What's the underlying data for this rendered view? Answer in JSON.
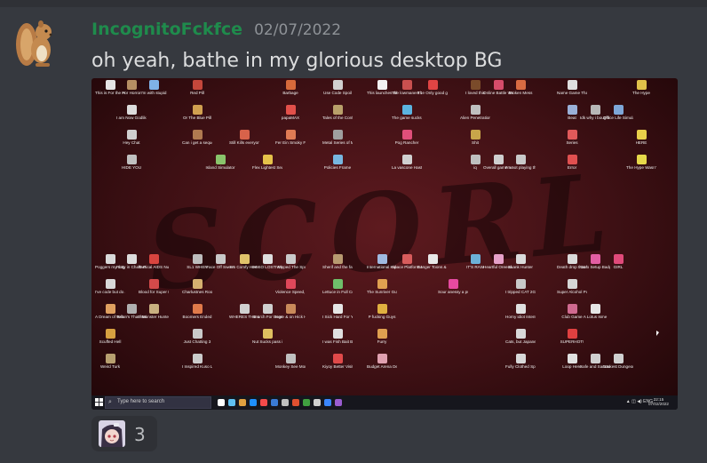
{
  "message": {
    "username": "IncognitoFckfce",
    "timestamp": "02/07/2022",
    "text": "oh yeah, bathe in my glorious desktop BG",
    "name_color": "#1f8b4c"
  },
  "attachment": {
    "wallpaper_text": "SCORL",
    "desktop_icons": [
      {
        "label": "This is For the Horror",
        "color": "#e5e5e5",
        "icon": "recycle-bin-icon"
      },
      {
        "label": "For Horror",
        "color": "#b58f63"
      },
      {
        "label": "I'm with stupid",
        "color": "#7fb2e8"
      },
      {
        "label": "Red Pill",
        "color": "#c4473b"
      },
      {
        "label": "Barbage",
        "color": "#d76a3b"
      },
      {
        "label": "Use Code Spoil",
        "color": "#d0d0d0"
      },
      {
        "label": "This launches Shitty Yt",
        "color": "#f2f2f2"
      },
      {
        "label": "The lowmanent 2",
        "color": "#c9504f"
      },
      {
        "label": "The Only good gu...",
        "color": "#e04444"
      },
      {
        "label": "I loved this",
        "color": "#7a4b2a"
      },
      {
        "label": "Online Battle Waifu creator",
        "color": "#d64c6a"
      },
      {
        "label": "Broken Mess",
        "color": "#d86b42"
      },
      {
        "label": "Name Game Thanks You",
        "color": "#dfdfdf"
      },
      {
        "label": "The Hype",
        "color": "#e0c24a"
      },
      {
        "label": "I am Now Godlike",
        "color": "#dcdcdc"
      },
      {
        "label": "Or The Blue Pill",
        "color": "#d0a050"
      },
      {
        "label": "papaMAX",
        "color": "#e2504a"
      },
      {
        "label": "Tales of the Configuration",
        "color": "#b9a06a"
      },
      {
        "label": "The game sucks. fu...",
        "color": "#5bb4e0"
      },
      {
        "label": "Alien Penetration",
        "color": "#bfbfbf"
      },
      {
        "label": "Beat",
        "color": "#9ab0d8"
      },
      {
        "label": "Idk why i bought this",
        "color": "#b7b7b7"
      },
      {
        "label": "Office Life Simulator",
        "color": "#7ea7d8"
      },
      {
        "label": "Hey Chat",
        "color": "#cfcfcf"
      },
      {
        "label": "Can i get a sequel",
        "color": "#b07a50"
      },
      {
        "label": "Still Kills everyone...",
        "color": "#d7624a"
      },
      {
        "label": "Fer Ein Smoky Face",
        "color": "#e07b54"
      },
      {
        "label": "Metal Series of Madness",
        "color": "#9f9f9f"
      },
      {
        "label": "Pog Rancher",
        "color": "#e04f7a"
      },
      {
        "label": "Shit",
        "color": "#c8a64a"
      },
      {
        "label": "Series",
        "color": "#e05a5a"
      },
      {
        "label": "HERE",
        "color": "#e8d04a"
      },
      {
        "label": "HIDE YOU",
        "color": "#c0c0c0"
      },
      {
        "label": "Island Simulator",
        "color": "#89c46b"
      },
      {
        "label": "Flex Lightest Seat Ever",
        "color": "#e5c24a"
      },
      {
        "label": "Policies Frame",
        "color": "#77b7e0"
      },
      {
        "label": "La vascone Hasty",
        "color": "#d0d0d0"
      },
      {
        "label": "iq",
        "color": "#bfbfbf"
      },
      {
        "label": "Overall game no...",
        "color": "#cfcfcf"
      },
      {
        "label": "I'm not playing this",
        "color": "#c9c9c9"
      },
      {
        "label": "Error",
        "color": "#e05050"
      },
      {
        "label": "The Hype Wasn't Here",
        "color": "#e6d84a"
      },
      {
        "label": "Poggers my doggers",
        "color": "#d9d9d9"
      },
      {
        "label": "Potty in Chafe Pants",
        "color": "#dcdcdc"
      },
      {
        "label": "Tactical AIDS Nuke",
        "color": "#d8453f"
      },
      {
        "label": "SL1 WHEN",
        "color": "#bdbdbd"
      },
      {
        "label": "Face Off Sweet",
        "color": "#c8c8c8"
      },
      {
        "label": "I'm Comfy Here",
        "color": "#e0c26a"
      },
      {
        "label": "IM SO LOST WHATS THIS",
        "color": "#dedede"
      },
      {
        "label": "I Kipped The Spot",
        "color": "#cacaca"
      },
      {
        "label": "Sherif and the fate o...",
        "color": "#b89a70"
      },
      {
        "label": "International Kid Terrorist",
        "color": "#9fb9e0"
      },
      {
        "label": "Space Platform 6.75",
        "color": "#d85c5c"
      },
      {
        "label": "Banger Toons & Headbook",
        "color": "#e8e8e8"
      },
      {
        "label": "IT'S RAW",
        "color": "#6cb0d8"
      },
      {
        "label": "Heartful Oreena Key",
        "color": "#e5a0c8"
      },
      {
        "label": "Skank Hunter",
        "color": "#dadada"
      },
      {
        "label": "Death drop that fat ass",
        "color": "#d9d9d9"
      },
      {
        "label": "Guro Setup Badge",
        "color": "#e25ea2"
      },
      {
        "label": "GIRL",
        "color": "#e04a7a"
      },
      {
        "label": "I've code but do actually...",
        "color": "#d8d8d8"
      },
      {
        "label": "Blood for Super Kiel",
        "color": "#d24a4a"
      },
      {
        "label": "Charlustnes Room",
        "color": "#d5b070"
      },
      {
        "label": "Violence Speed, M...",
        "color": "#e0485a"
      },
      {
        "label": "Lettuce in Full Cotton",
        "color": "#6fbf6a"
      },
      {
        "label": "The Sunriver Guys",
        "color": "#e0a050"
      },
      {
        "label": "Sour anessy a punk",
        "color": "#e64aa0"
      },
      {
        "label": "I tripped CAT 2G & BATH",
        "color": "#c9c9c9"
      },
      {
        "label": "Super Alcohol Puzzle",
        "color": "#d6d6d6"
      },
      {
        "label": "A Dream of Iran Make 2",
        "color": "#e0a060"
      },
      {
        "label": "Tellan's That Walls",
        "color": "#b0b0b0"
      },
      {
        "label": "If Monster Hunter m...",
        "color": "#c9b080"
      },
      {
        "label": "Boomers Ended",
        "color": "#e07a4a"
      },
      {
        "label": "WHERES THE LAMB SAUCE",
        "color": "#d0d0d0"
      },
      {
        "label": "Search For Bugs Daps",
        "color": "#cfcfcf"
      },
      {
        "label": "Here & on Hick Hatspring",
        "color": "#c98a5a"
      },
      {
        "label": "I Sick Hard For You",
        "color": "#e6e6e6"
      },
      {
        "label": "P fucking Guys",
        "color": "#e0b040"
      },
      {
        "label": "Horny idiot Intent Sims",
        "color": "#e0e0e0"
      },
      {
        "label": "Club Game",
        "color": "#d06a90"
      },
      {
        "label": "A Lotus Isme",
        "color": "#e5e5e5"
      },
      {
        "label": "Scuffed Hell",
        "color": "#d7a040"
      },
      {
        "label": "Just Chatting 3",
        "color": "#c9c9c9"
      },
      {
        "label": "Nut Sucks pass it on",
        "color": "#e0c060"
      },
      {
        "label": "I was Fish Bait Bot",
        "color": "#e0e0e0"
      },
      {
        "label": "Furry",
        "color": "#e0a050"
      },
      {
        "label": "Cats, but Japanese",
        "color": "#d8d8d8"
      },
      {
        "label": "SUPERHOT!",
        "color": "#e04040"
      },
      {
        "label": "Weird Turk",
        "color": "#b8a070"
      },
      {
        "label": "I Inspired Kuso Lichen",
        "color": "#cbcbcb"
      },
      {
        "label": "Monkey See Monkey Do",
        "color": "#c0c0c0"
      },
      {
        "label": "Kiyoy Better Visit My Ass",
        "color": "#e04a4a"
      },
      {
        "label": "Budget Arena Dead Island",
        "color": "#e0a0b0"
      },
      {
        "label": "Fully Clothed Sparkle Icon",
        "color": "#d8d8d8"
      },
      {
        "label": "Loop Here",
        "color": "#e0e0e0"
      },
      {
        "label": "Safe and Sanctuary",
        "color": "#cfcfcf"
      },
      {
        "label": "Darkest Dungeon I...",
        "color": "#d0d0d0"
      }
    ],
    "taskbar": {
      "search_placeholder": "Type here to search",
      "tray_text": "ENG",
      "clock_time": "22:15",
      "clock_date": "07/02/2022",
      "pinned_colors": [
        "#ffffff",
        "#60c0f0",
        "#e0a040",
        "#1e90ff",
        "#f44a4a",
        "#3a7bd5",
        "#c0c0c0",
        "#e05030",
        "#40a040",
        "#d0d0d0",
        "#3a86ff",
        "#9a5cd0"
      ]
    }
  },
  "reaction": {
    "count": "3",
    "emoji": "anime-character-emoji"
  }
}
